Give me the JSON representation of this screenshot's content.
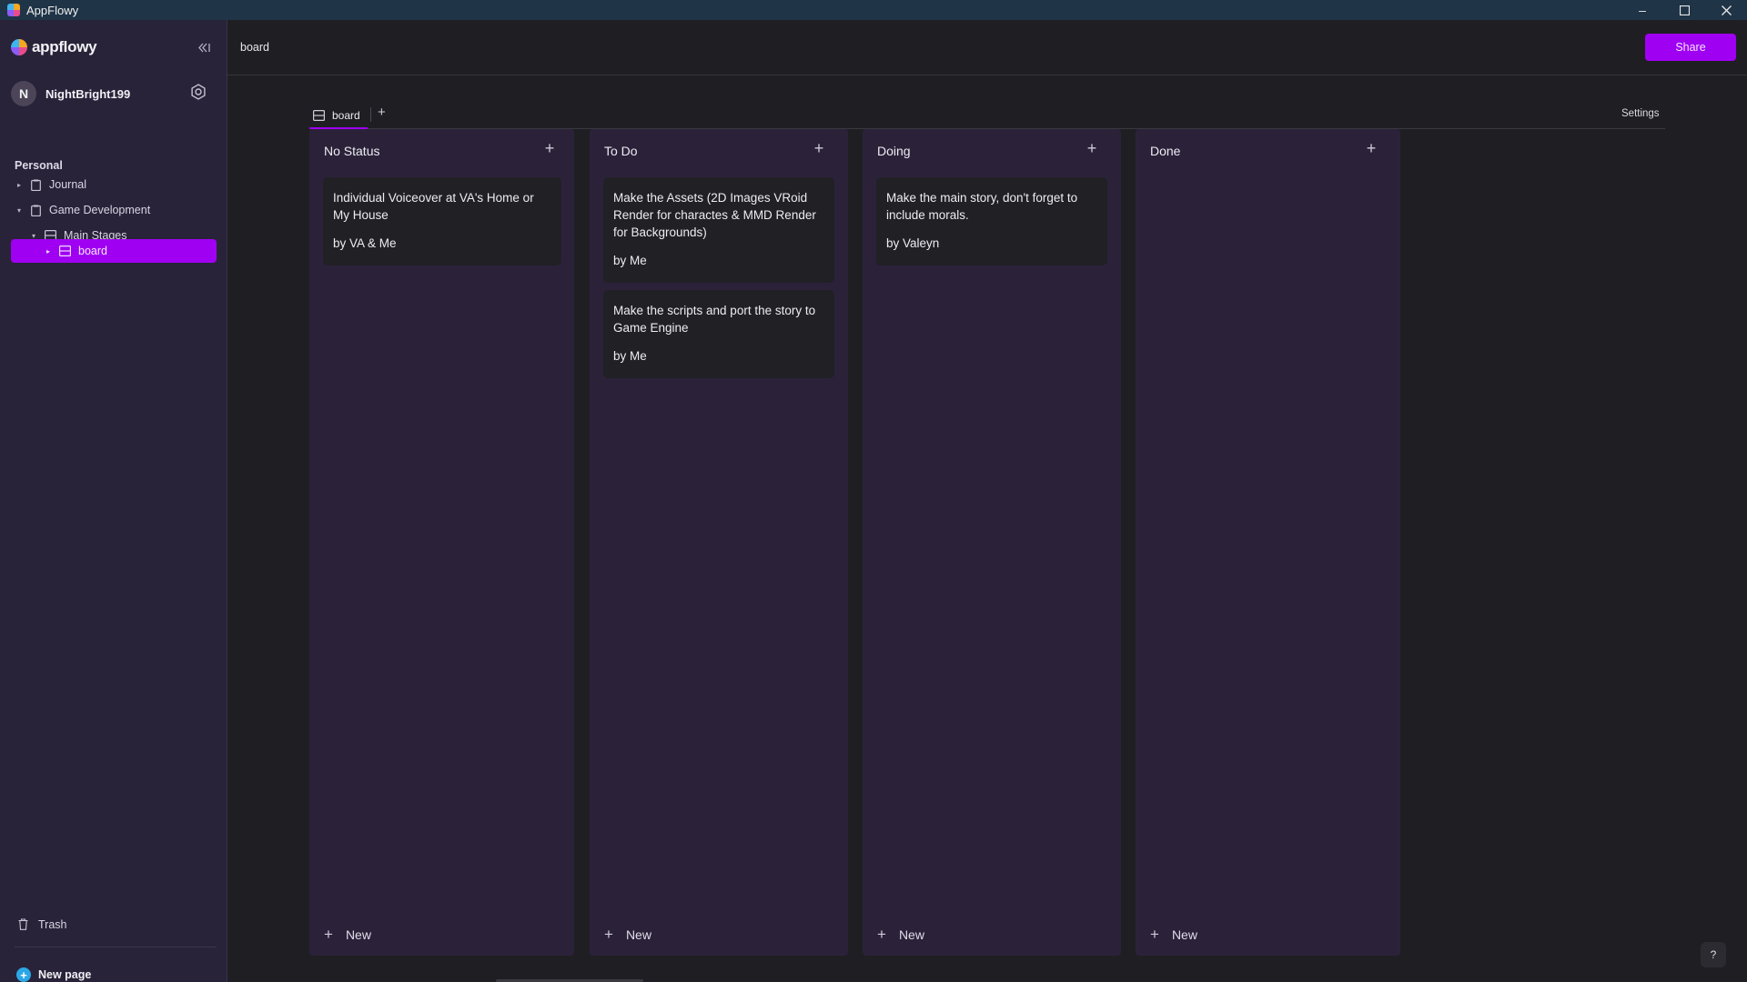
{
  "window": {
    "title": "AppFlowy"
  },
  "sidebar": {
    "logo_text": "appflowy",
    "user": {
      "initial": "N",
      "name": "NightBright199"
    },
    "section": "Personal",
    "tree": [
      {
        "label": "Journal",
        "icon": "document-icon",
        "expanded": false
      },
      {
        "label": "Game Development",
        "icon": "document-icon",
        "expanded": true
      },
      {
        "label": "Main Stages",
        "icon": "board-icon",
        "expanded": true
      },
      {
        "label": "board",
        "icon": "board-icon",
        "selected": true
      }
    ],
    "trash": "Trash",
    "new_page": "New page"
  },
  "header": {
    "breadcrumb": "board",
    "share_label": "Share"
  },
  "views": {
    "active_tab": "board",
    "add_symbol": "+",
    "settings_label": "Settings"
  },
  "board": {
    "new_label": "New",
    "columns": [
      {
        "title": "No Status",
        "cards": [
          {
            "title": "Individual Voiceover at VA's Home or My House",
            "by": "by VA & Me"
          }
        ]
      },
      {
        "title": "To Do",
        "cards": [
          {
            "title": "Make the Assets (2D Images VRoid Render for charactes & MMD Render for Backgrounds)",
            "by": "by Me"
          },
          {
            "title": "Make the scripts and port the story to Game Engine",
            "by": "by Me"
          }
        ]
      },
      {
        "title": "Doing",
        "cards": [
          {
            "title": "Make the main story, don't forget to include morals.",
            "by": "by Valeyn"
          }
        ]
      },
      {
        "title": "Done",
        "cards": []
      }
    ]
  },
  "help_label": "?",
  "colors": {
    "accent": "#a000f2",
    "sidebar_bg": "#29233a",
    "column_bg": "#2b223a",
    "card_bg": "#212025"
  }
}
